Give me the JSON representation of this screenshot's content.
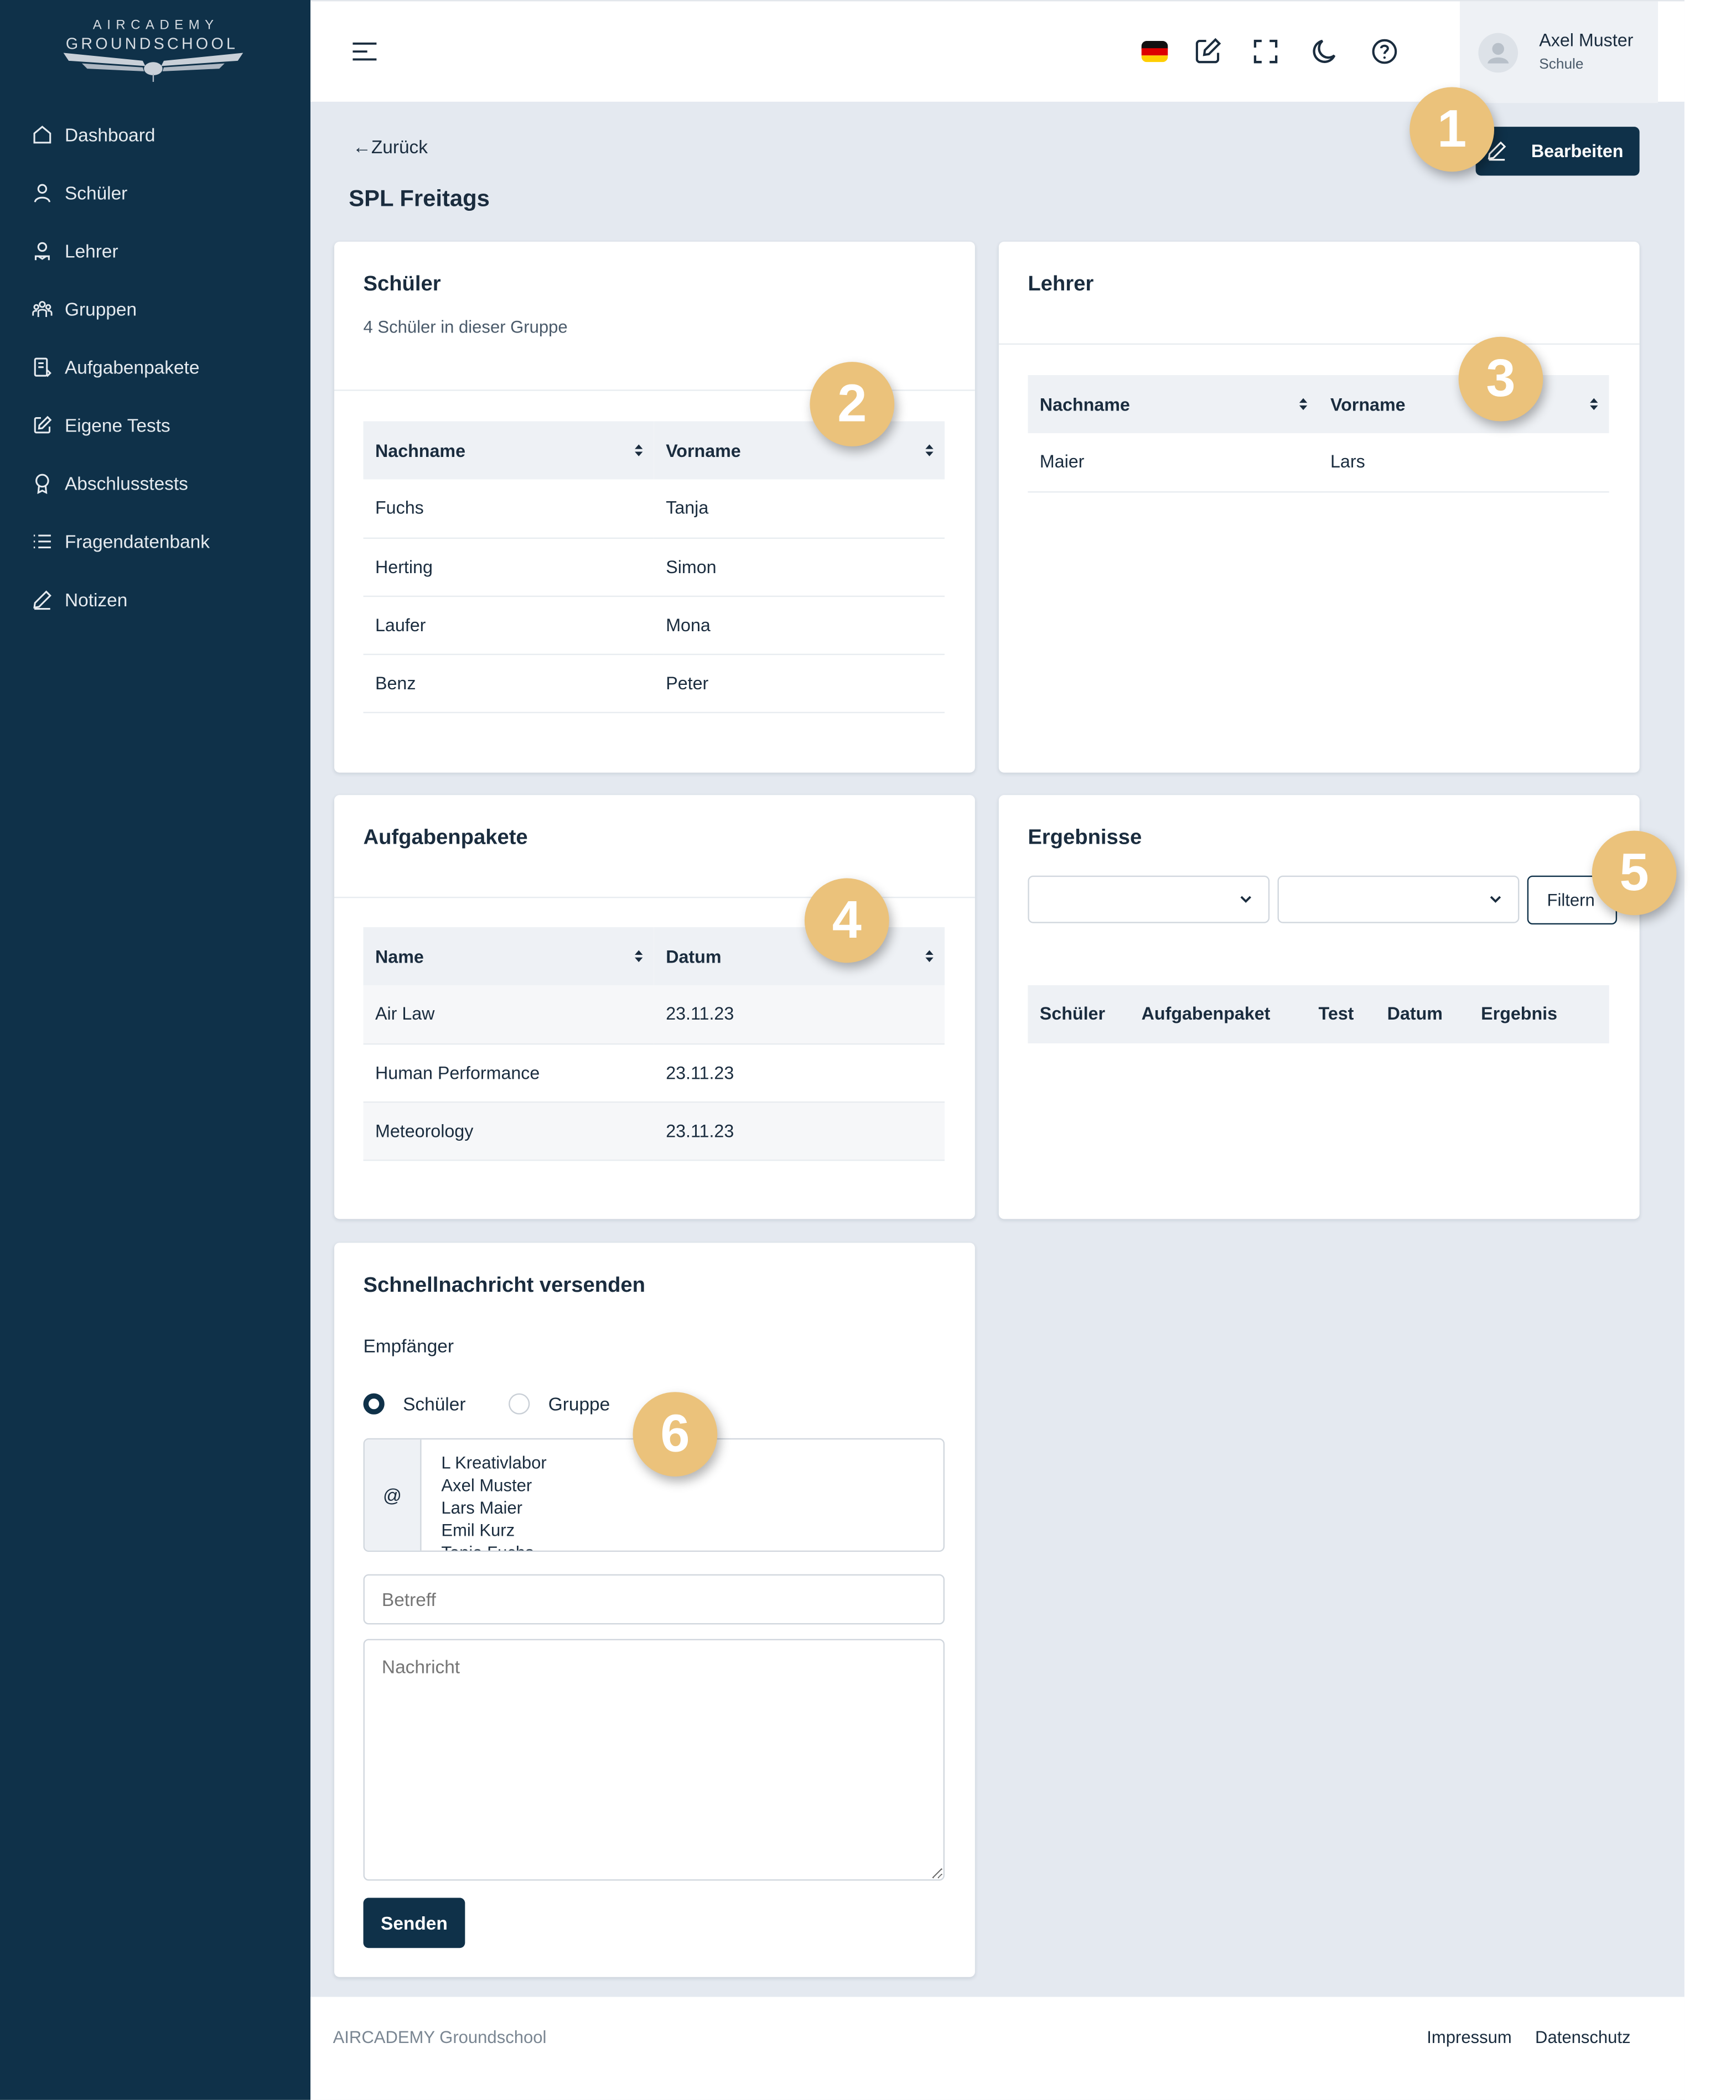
{
  "brand": {
    "line1": "AIRCADEMY",
    "line2": "GROUNDSCHOOL"
  },
  "sidebar": {
    "items": [
      {
        "label": "Dashboard",
        "icon": "home-icon"
      },
      {
        "label": "Schüler",
        "icon": "user-icon"
      },
      {
        "label": "Lehrer",
        "icon": "teacher-icon"
      },
      {
        "label": "Gruppen",
        "icon": "group-icon"
      },
      {
        "label": "Aufgabenpakete",
        "icon": "package-icon"
      },
      {
        "label": "Eigene Tests",
        "icon": "edit-square-icon"
      },
      {
        "label": "Abschlusstests",
        "icon": "award-icon"
      },
      {
        "label": "Fragendatenbank",
        "icon": "list-icon"
      },
      {
        "label": "Notizen",
        "icon": "pencil-icon"
      }
    ]
  },
  "header": {
    "user_name": "Axel Muster",
    "user_role": "Schule",
    "icons": [
      "menu-icon",
      "german-flag-icon",
      "notes-icon",
      "fullscreen-icon",
      "moon-icon",
      "help-icon"
    ]
  },
  "page": {
    "back_label": "Zurück",
    "title": "SPL Freitags",
    "edit_label": "Bearbeiten"
  },
  "students": {
    "title": "Schüler",
    "subtitle": "4 Schüler in dieser Gruppe",
    "columns": [
      "Nachname",
      "Vorname"
    ],
    "rows": [
      [
        "Fuchs",
        "Tanja"
      ],
      [
        "Herting",
        "Simon"
      ],
      [
        "Laufer",
        "Mona"
      ],
      [
        "Benz",
        "Peter"
      ]
    ]
  },
  "teachers": {
    "title": "Lehrer",
    "columns": [
      "Nachname",
      "Vorname"
    ],
    "rows": [
      [
        "Maier",
        "Lars"
      ]
    ]
  },
  "packages": {
    "title": "Aufgabenpakete",
    "columns": [
      "Name",
      "Datum"
    ],
    "rows": [
      [
        "Air Law",
        "23.11.23"
      ],
      [
        "Human Performance",
        "23.11.23"
      ],
      [
        "Meteorology",
        "23.11.23"
      ]
    ]
  },
  "results": {
    "title": "Ergebnisse",
    "filter_label": "Filtern",
    "columns": [
      "Schüler",
      "Aufgabenpaket",
      "Test",
      "Datum",
      "Ergebnis"
    ]
  },
  "message": {
    "title": "Schnellnachricht versenden",
    "recipient_label": "Empfänger",
    "radio_student": "Schüler",
    "radio_group": "Gruppe",
    "at_symbol": "@",
    "recipients": [
      "L Kreativlabor",
      "Axel Muster",
      "Lars Maier",
      "Emil Kurz",
      "Tanja Fuchs"
    ],
    "subject_placeholder": "Betreff",
    "body_placeholder": "Nachricht",
    "send_label": "Senden"
  },
  "badges": [
    "1",
    "2",
    "3",
    "4",
    "5",
    "6"
  ],
  "footer": {
    "left": "AIRCADEMY Groundschool",
    "impressum": "Impressum",
    "datenschutz": "Datenschutz"
  },
  "colors": {
    "sidebar": "#0f3149",
    "accent": "#0f3149",
    "badge": "#ebc27b",
    "background": "#e4e9f0"
  }
}
